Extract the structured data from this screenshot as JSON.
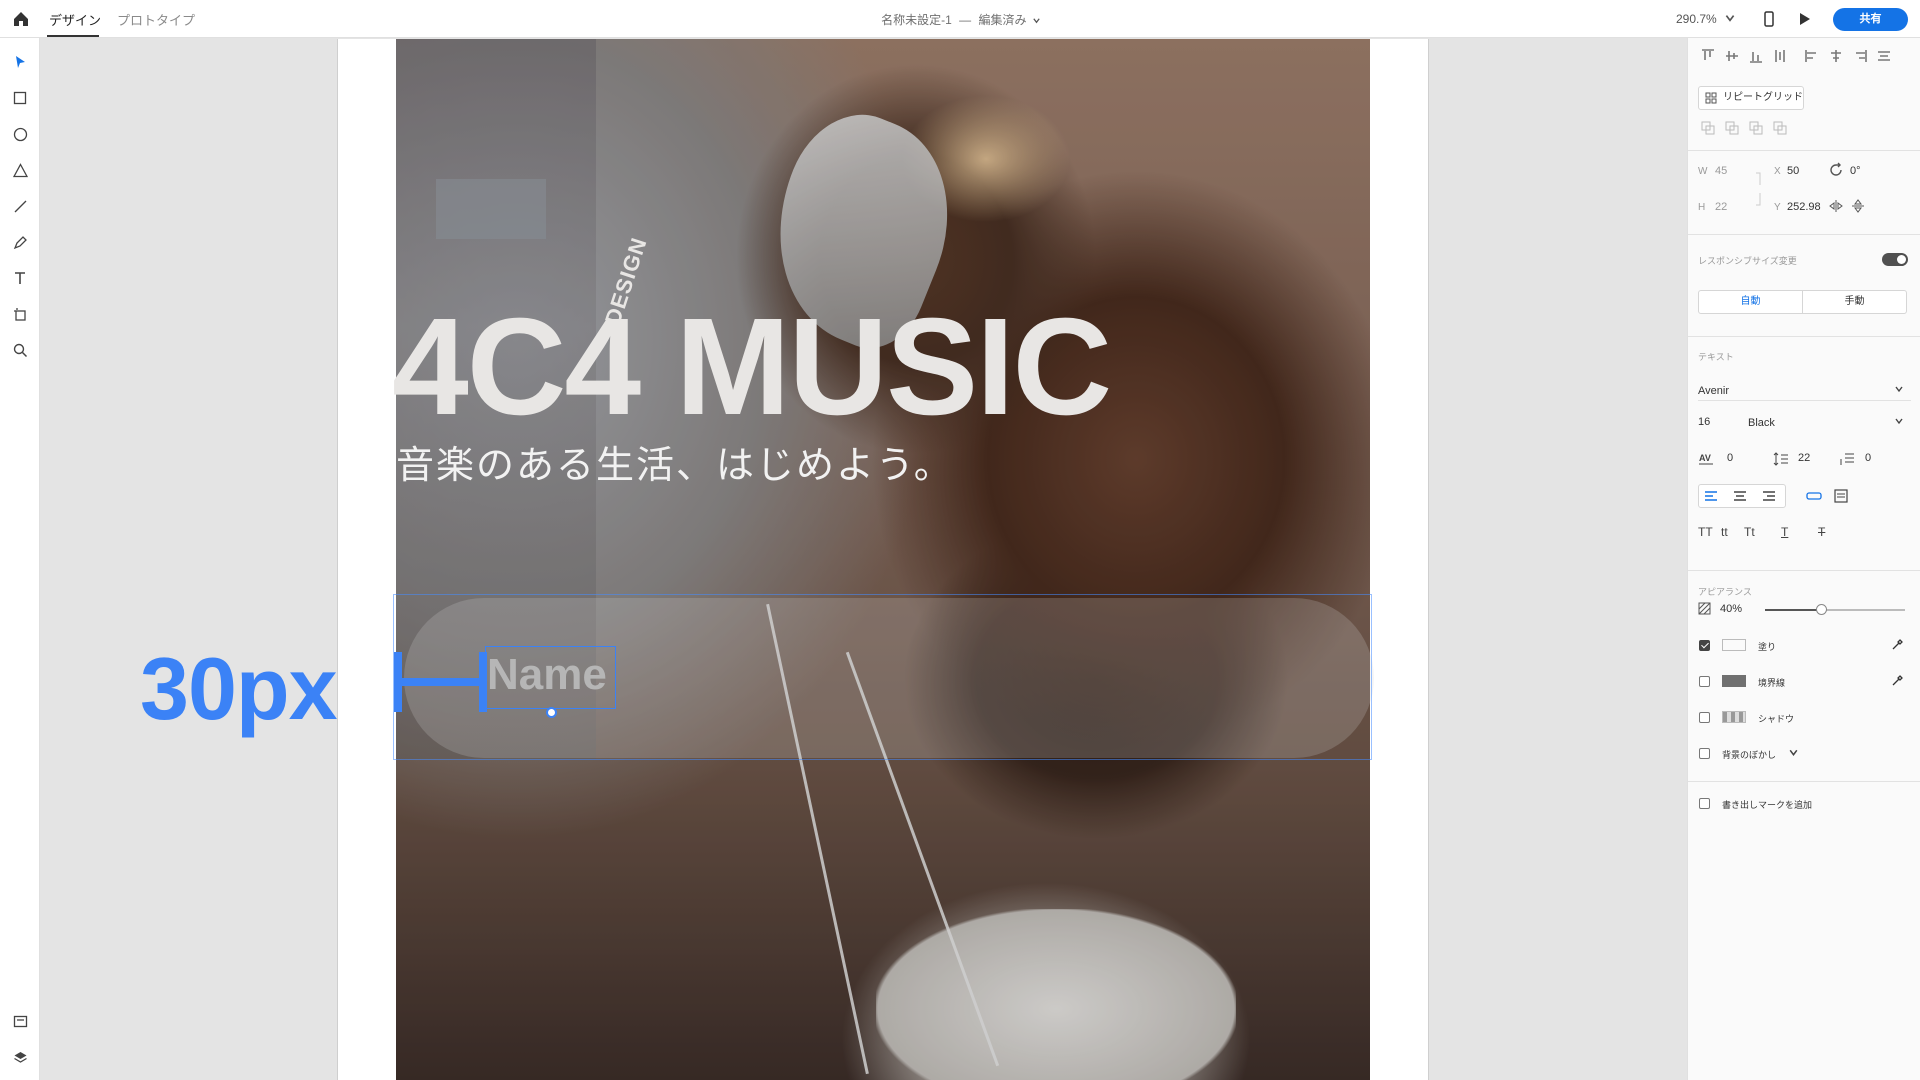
{
  "topbar": {
    "tabs": [
      {
        "label": "デザイン",
        "active": true
      },
      {
        "label": "プロトタイプ",
        "active": false
      }
    ],
    "doc_name": "名称未設定-1",
    "doc_separator": "—",
    "doc_status": "編集済み",
    "zoom": "290.7%",
    "share_label": "共有",
    "accent": "#1473e6"
  },
  "toolbar": {
    "tools": [
      "select-icon",
      "rectangle-icon",
      "ellipse-icon",
      "triangle-icon",
      "line-icon",
      "pen-icon",
      "text-icon",
      "artboard-icon",
      "zoom-icon"
    ],
    "bottom": [
      "assets-icon",
      "layers-icon"
    ]
  },
  "canvas": {
    "brand_text": "4C4 MUSIC",
    "brand_design": "DESIGN",
    "tagline": "音楽のある生活、はじめよう。",
    "name_text": "Name",
    "spacing_label": "30px",
    "spacing_color": "#3b82f6"
  },
  "panel": {
    "repeat_grid_label": "リピートグリッド",
    "w_label": "W",
    "w_value": "45",
    "h_label": "H",
    "h_value": "22",
    "x_label": "X",
    "x_value": "50",
    "y_label": "Y",
    "y_value": "252.98",
    "rotation": "0°",
    "responsive_label": "レスポンシブサイズ変更",
    "responsive_on": true,
    "seg_auto": "自動",
    "seg_manual": "手動",
    "text_section": "テキスト",
    "font_family": "Avenir",
    "font_size": "16",
    "font_weight": "Black",
    "char_spacing": "0",
    "line_spacing": "22",
    "para_spacing": "0",
    "tt_upper": "TT",
    "tt_lower": "tt",
    "tt_title": "Tt",
    "tt_underline": "T",
    "tt_strike": "T",
    "appearance_section": "アピアランス",
    "opacity": "40%",
    "opacity_value": 0.4,
    "fill_label": "塗り",
    "fill_checked": true,
    "fill_color": "#ffffff",
    "border_label": "境界線",
    "border_checked": false,
    "border_color": "#707070",
    "shadow_label": "シャドウ",
    "shadow_checked": false,
    "blur_label": "背景のぼかし",
    "blur_checked": false,
    "callout_label": "書き出しマークを追加",
    "callout_checked": false
  }
}
